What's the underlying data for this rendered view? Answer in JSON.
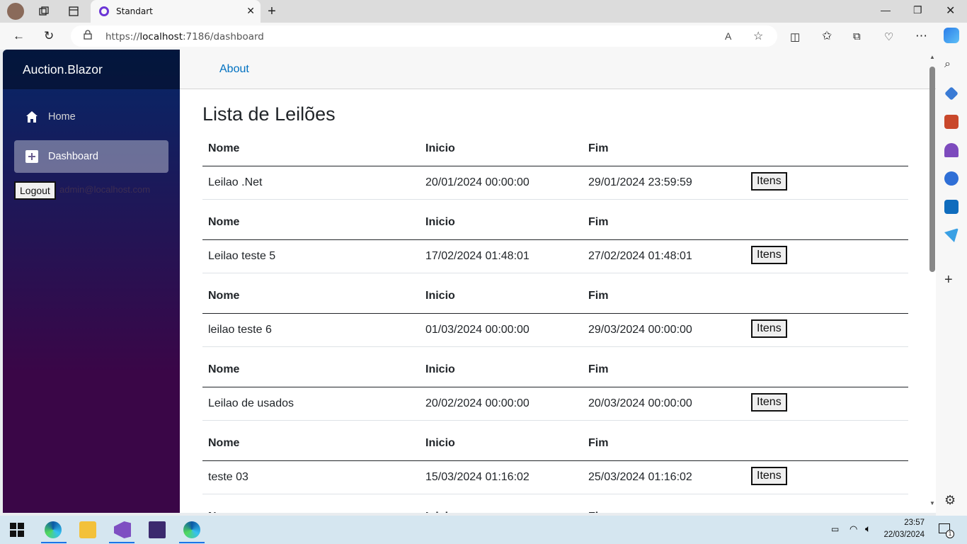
{
  "browser": {
    "tab_title": "Standart",
    "url_host": "https://",
    "url_main": "localhost",
    "url_rest": ":7186/dashboard"
  },
  "app": {
    "brand": "Auction.Blazor",
    "nav": [
      {
        "label": "Home",
        "icon": "home-icon"
      },
      {
        "label": "Dashboard",
        "icon": "plus-square-icon"
      }
    ],
    "logout_label": "Logout",
    "user_email": "admin@localhost.com",
    "top_link": "About"
  },
  "page": {
    "title": "Lista de Leilões",
    "columns": [
      "Nome",
      "Inicio",
      "Fim"
    ],
    "action_label": "Itens",
    "auctions": [
      {
        "nome": "Leilao .Net",
        "inicio": "20/01/2024 00:00:00",
        "fim": "29/01/2024 23:59:59"
      },
      {
        "nome": "Leilao teste 5",
        "inicio": "17/02/2024 01:48:01",
        "fim": "27/02/2024 01:48:01"
      },
      {
        "nome": "leilao teste 6",
        "inicio": "01/03/2024 00:00:00",
        "fim": "29/03/2024 00:00:00"
      },
      {
        "nome": "Leilao de usados",
        "inicio": "20/02/2024 00:00:00",
        "fim": "20/03/2024 00:00:00"
      },
      {
        "nome": "teste 03",
        "inicio": "15/03/2024 01:16:02",
        "fim": "25/03/2024 01:16:02"
      }
    ]
  },
  "taskbar": {
    "time": "23:57",
    "date": "22/03/2024",
    "notification_count": "1"
  },
  "colors": {
    "sidebar_top": "#052767",
    "sidebar_bottom": "#3a0647",
    "link": "#0071c1",
    "tab_favicon": "#6b35d6"
  }
}
